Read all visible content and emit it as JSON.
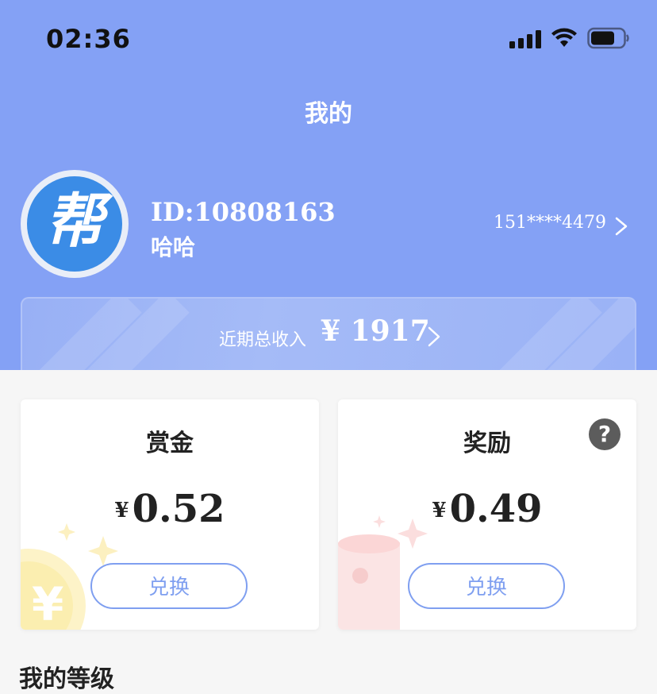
{
  "status_bar": {
    "time": "02:36"
  },
  "header": {
    "title": "我的"
  },
  "profile": {
    "avatar_text": "帮",
    "id_text": "ID:10808163",
    "name": "哈哈",
    "phone": "151****4479"
  },
  "income": {
    "label": "近期总收入",
    "value": "¥ 1917"
  },
  "cards": {
    "bounty": {
      "title": "赏金",
      "currency": "¥",
      "amount": "0.52",
      "button": "兑换"
    },
    "reward": {
      "title": "奖励",
      "currency": "¥",
      "amount": "0.49",
      "button": "兑换",
      "help": "?"
    }
  },
  "sections": {
    "level_title": "我的等级"
  },
  "colors": {
    "header_bg": "#84a1f5",
    "accent": "#7f9ff0",
    "page_bg": "#f6f6f6"
  },
  "icons": [
    "signal-icon",
    "wifi-icon",
    "battery-icon",
    "chevron-right-icon",
    "help-icon"
  ]
}
